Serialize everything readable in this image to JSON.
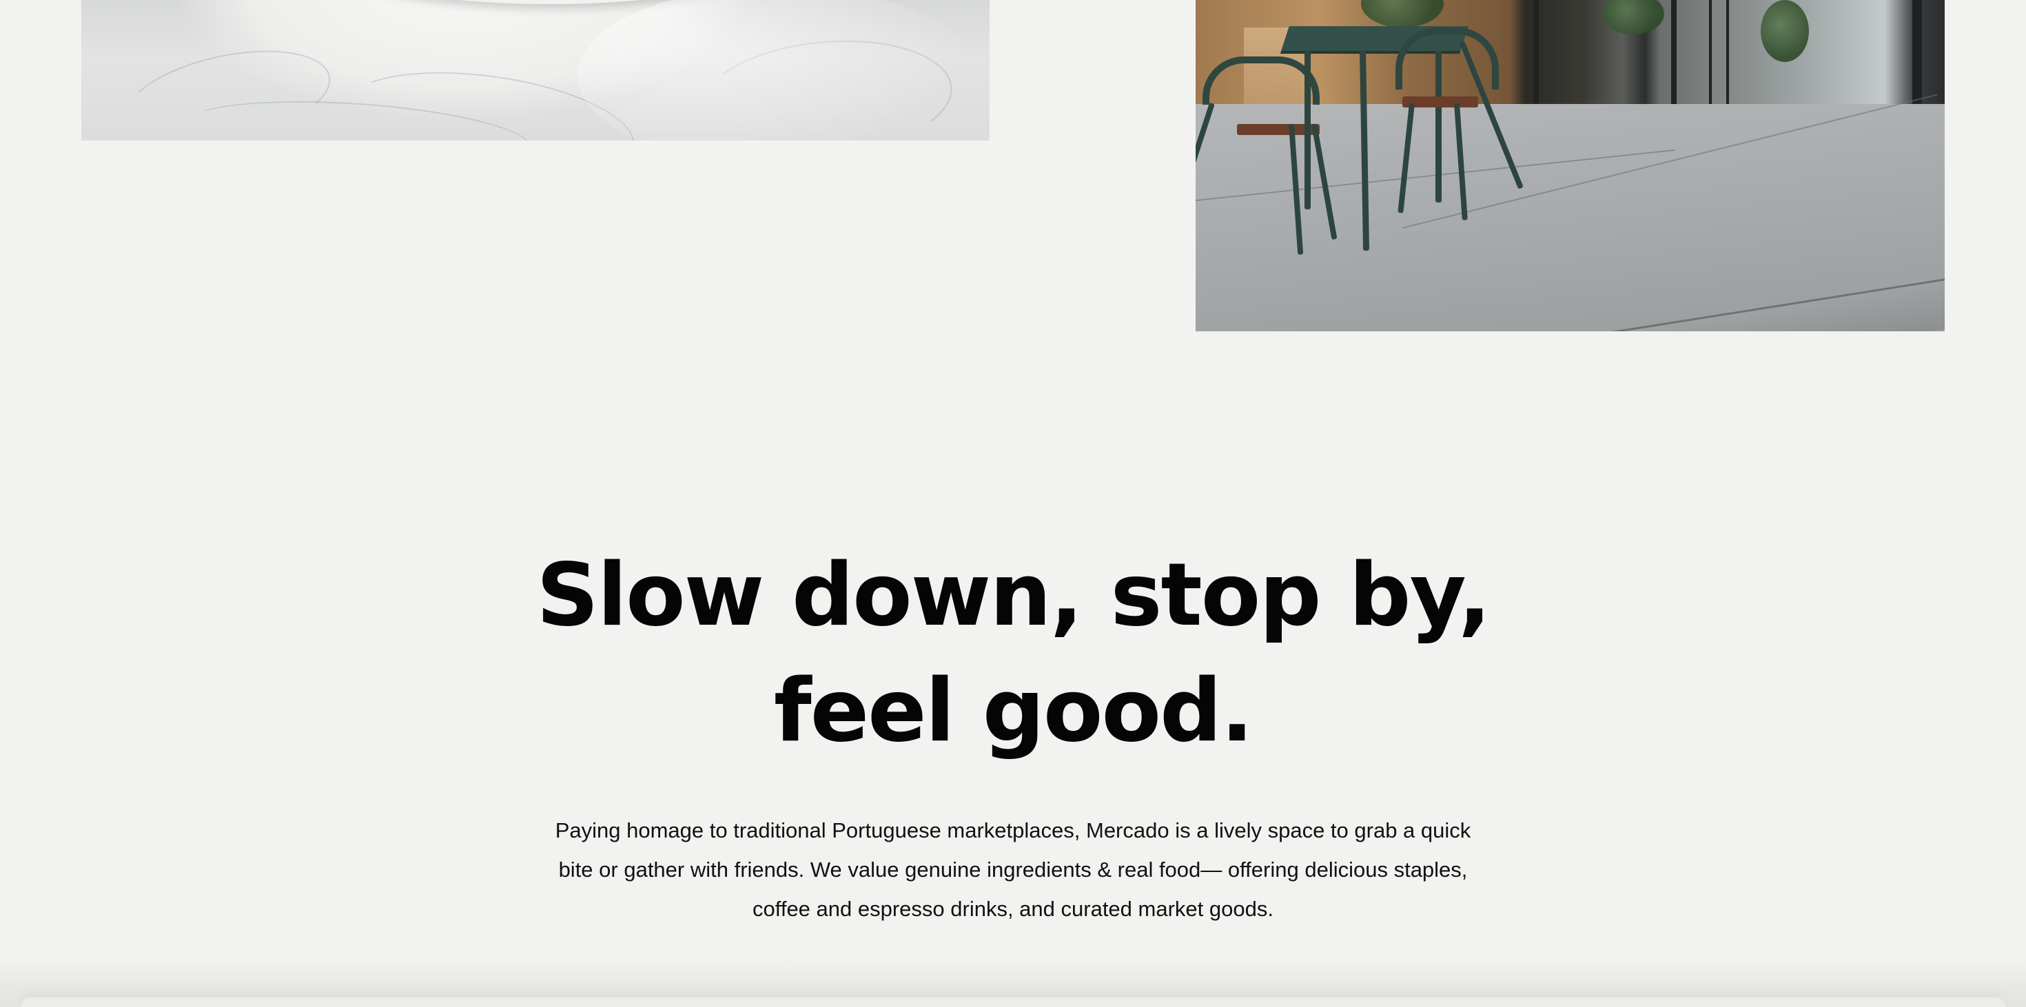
{
  "gallery": {
    "left_image": {
      "subject": "marble-counter-plate"
    },
    "right_image": {
      "subject": "storefront-bistro-table"
    }
  },
  "intro": {
    "headline_line_1": "Slow down, stop by,",
    "headline_line_2": "feel good.",
    "body_line_1": "Paying homage to traditional Portuguese marketplaces, Mercado is a lively space to grab a quick",
    "body_line_2": "bite or gather with friends. We value genuine ingredients & real food— offering delicious staples,",
    "body_line_3": "coffee and espresso drinks, and curated market goods."
  },
  "colors": {
    "background": "#f2f2f0",
    "text": "#050505"
  }
}
